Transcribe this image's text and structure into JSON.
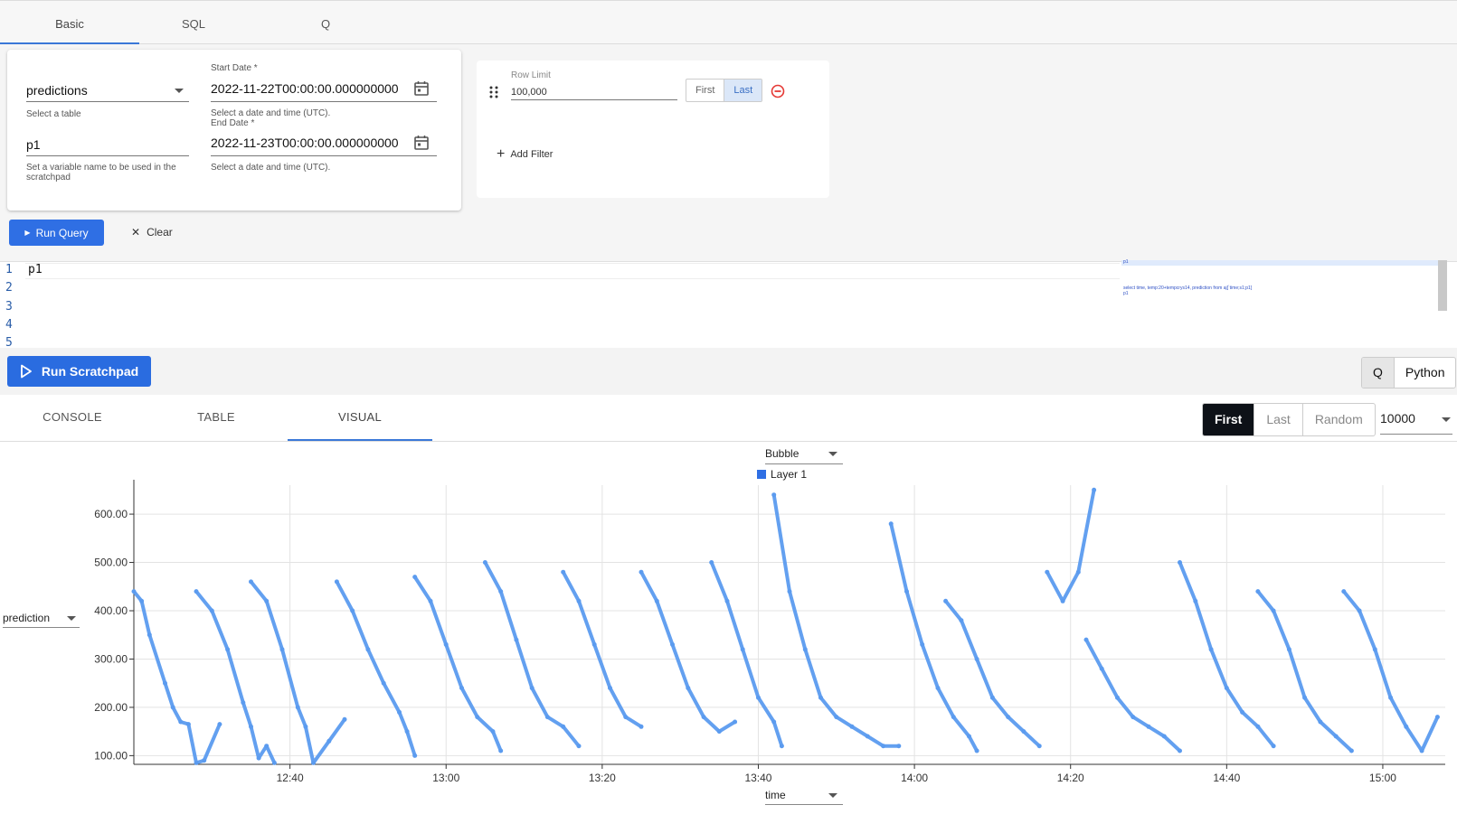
{
  "top_tabs": [
    "Basic",
    "SQL",
    "Q"
  ],
  "query": {
    "table": {
      "value": "predictions",
      "hint": "Select a table"
    },
    "variable": {
      "value": "p1",
      "hint": "Set a variable name to be used in the scratchpad"
    },
    "start_date": {
      "label": "Start Date *",
      "value": "2022-11-22T00:00:00.000000000",
      "hint": "Select a date and time (UTC)."
    },
    "end_date": {
      "label": "End Date *",
      "value": "2022-11-23T00:00:00.000000000",
      "hint": "Select a date and time (UTC)."
    },
    "row_limit": {
      "label": "Row Limit",
      "value": "100,000",
      "options": [
        "First",
        "Last"
      ],
      "selected": "Last"
    },
    "add_filter": "Add Filter",
    "run_query": "Run Query",
    "clear": "Clear"
  },
  "editor": {
    "line_numbers": [
      "1",
      "2",
      "3",
      "4",
      "5"
    ],
    "lines": [
      "p1",
      "",
      "",
      "",
      ""
    ],
    "minimap_lines": [
      "p1",
      "select time, temp:20+tempcrys14, prediction from aj[`time;s1;p1]",
      "p1"
    ]
  },
  "scratchpad": {
    "run_label": "Run Scratchpad",
    "languages": [
      "Q",
      "Python"
    ],
    "selected_language": "Q"
  },
  "result_tabs": [
    "CONSOLE",
    "TABLE",
    "VISUAL"
  ],
  "active_result_tab": "VISUAL",
  "sampling": {
    "options": [
      "First",
      "Last",
      "Random"
    ],
    "selected": "First",
    "count": "10000"
  },
  "visual": {
    "chart_type_select": "Bubble",
    "legend": "Layer 1",
    "y_select": "prediction",
    "x_select": "time"
  },
  "colors": {
    "accent": "#2f6fe4",
    "series": "#5b9bef",
    "danger": "#e53935"
  },
  "chart_data": {
    "type": "scatter",
    "xlabel": "time",
    "ylabel": "prediction",
    "x_ticks": [
      "12:40",
      "13:00",
      "13:20",
      "13:40",
      "14:00",
      "14:20",
      "14:40",
      "15:00"
    ],
    "y_ticks": [
      "100.00",
      "200.00",
      "300.00",
      "400.00",
      "500.00",
      "600.00"
    ],
    "x_range": [
      "12:20",
      "15:08"
    ],
    "ylim": [
      82,
      660
    ],
    "grid": true,
    "legend_position": "top-center",
    "series": [
      {
        "name": "Layer 1",
        "segments": [
          [
            [
              "12:20",
              440
            ],
            [
              "12:21",
              420
            ],
            [
              "12:22",
              350
            ],
            [
              "12:24",
              250
            ],
            [
              "12:25",
              200
            ],
            [
              "12:26",
              170
            ],
            [
              "12:27",
              165
            ],
            [
              "12:28",
              85
            ],
            [
              "12:29",
              90
            ],
            [
              "12:31",
              165
            ]
          ],
          [
            [
              "12:28",
              440
            ],
            [
              "12:30",
              400
            ],
            [
              "12:32",
              320
            ],
            [
              "12:34",
              210
            ],
            [
              "12:35",
              160
            ],
            [
              "12:36",
              95
            ],
            [
              "12:37",
              120
            ],
            [
              "12:38",
              85
            ]
          ],
          [
            [
              "12:35",
              460
            ],
            [
              "12:37",
              420
            ],
            [
              "12:39",
              320
            ],
            [
              "12:41",
              200
            ],
            [
              "12:42",
              160
            ],
            [
              "12:43",
              85
            ],
            [
              "12:45",
              130
            ],
            [
              "12:47",
              175
            ]
          ],
          [
            [
              "12:46",
              460
            ],
            [
              "12:48",
              400
            ],
            [
              "12:50",
              320
            ],
            [
              "12:52",
              250
            ],
            [
              "12:54",
              190
            ],
            [
              "12:55",
              150
            ],
            [
              "12:56",
              100
            ]
          ],
          [
            [
              "12:56",
              470
            ],
            [
              "12:58",
              420
            ],
            [
              "13:00",
              330
            ],
            [
              "13:02",
              240
            ],
            [
              "13:04",
              180
            ],
            [
              "13:06",
              150
            ],
            [
              "13:07",
              110
            ]
          ],
          [
            [
              "13:05",
              500
            ],
            [
              "13:07",
              440
            ],
            [
              "13:09",
              340
            ],
            [
              "13:11",
              240
            ],
            [
              "13:13",
              180
            ],
            [
              "13:15",
              160
            ],
            [
              "13:17",
              120
            ]
          ],
          [
            [
              "13:15",
              480
            ],
            [
              "13:17",
              420
            ],
            [
              "13:19",
              330
            ],
            [
              "13:21",
              240
            ],
            [
              "13:23",
              180
            ],
            [
              "13:25",
              160
            ]
          ],
          [
            [
              "13:25",
              480
            ],
            [
              "13:27",
              420
            ],
            [
              "13:29",
              330
            ],
            [
              "13:31",
              240
            ],
            [
              "13:33",
              180
            ],
            [
              "13:35",
              150
            ],
            [
              "13:37",
              170
            ]
          ],
          [
            [
              "13:34",
              500
            ],
            [
              "13:36",
              420
            ],
            [
              "13:38",
              320
            ],
            [
              "13:40",
              220
            ],
            [
              "13:42",
              170
            ],
            [
              "13:43",
              120
            ]
          ],
          [
            [
              "13:42",
              640
            ],
            [
              "13:44",
              440
            ],
            [
              "13:46",
              320
            ],
            [
              "13:48",
              220
            ],
            [
              "13:50",
              180
            ],
            [
              "13:52",
              160
            ],
            [
              "13:54",
              140
            ],
            [
              "13:56",
              120
            ],
            [
              "13:58",
              120
            ]
          ],
          [
            [
              "13:57",
              580
            ],
            [
              "13:59",
              440
            ],
            [
              "14:01",
              330
            ],
            [
              "14:03",
              240
            ],
            [
              "14:05",
              180
            ],
            [
              "14:07",
              140
            ],
            [
              "14:08",
              110
            ]
          ],
          [
            [
              "14:04",
              420
            ],
            [
              "14:06",
              380
            ],
            [
              "14:08",
              300
            ],
            [
              "14:10",
              220
            ],
            [
              "14:12",
              180
            ],
            [
              "14:14",
              150
            ],
            [
              "14:16",
              120
            ]
          ],
          [
            [
              "14:17",
              480
            ],
            [
              "14:19",
              420
            ],
            [
              "14:21",
              480
            ],
            [
              "14:23",
              650
            ]
          ],
          [
            [
              "14:22",
              340
            ],
            [
              "14:24",
              280
            ],
            [
              "14:26",
              220
            ],
            [
              "14:28",
              180
            ],
            [
              "14:30",
              160
            ],
            [
              "14:32",
              140
            ],
            [
              "14:34",
              110
            ]
          ],
          [
            [
              "14:34",
              500
            ],
            [
              "14:36",
              420
            ],
            [
              "14:38",
              320
            ],
            [
              "14:40",
              240
            ],
            [
              "14:42",
              190
            ],
            [
              "14:44",
              160
            ],
            [
              "14:46",
              120
            ]
          ],
          [
            [
              "14:44",
              440
            ],
            [
              "14:46",
              400
            ],
            [
              "14:48",
              320
            ],
            [
              "14:50",
              220
            ],
            [
              "14:52",
              170
            ],
            [
              "14:54",
              140
            ],
            [
              "14:56",
              110
            ]
          ],
          [
            [
              "14:55",
              440
            ],
            [
              "14:57",
              400
            ],
            [
              "14:59",
              320
            ],
            [
              "15:01",
              220
            ],
            [
              "15:03",
              160
            ],
            [
              "15:05",
              110
            ],
            [
              "15:07",
              180
            ]
          ]
        ]
      }
    ]
  }
}
